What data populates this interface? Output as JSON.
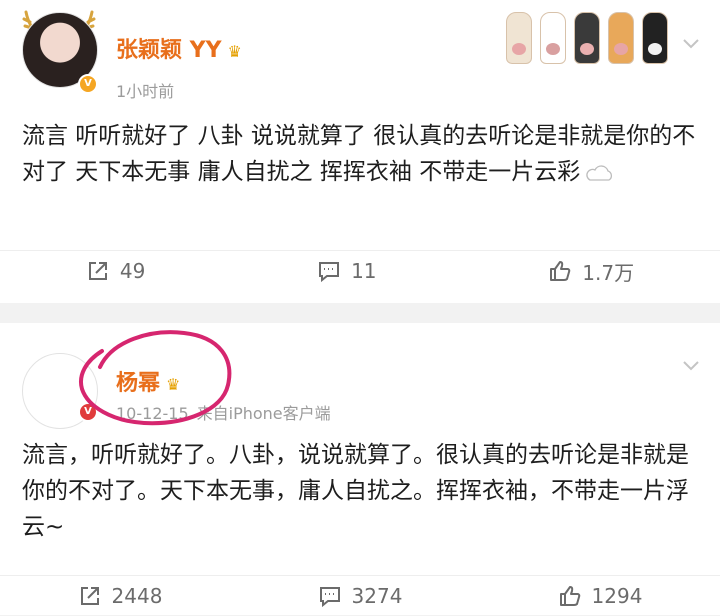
{
  "posts": [
    {
      "username": "张颖颖 YY",
      "time": "1小时前",
      "source": "",
      "text": "流言 听听就好了 八卦 说说就算了 很认真的去听论是非就是你的不对了 天下本无事 庸人自扰之 挥挥衣袖 不带走一片云彩",
      "reposts": "49",
      "comments": "11",
      "likes": "1.7万"
    },
    {
      "username": "杨幂",
      "time": "10-12-15",
      "source": "来自iPhone客户端",
      "text": "流言，听听就好了。八卦，说说就算了。很认真的去听论是非就是你的不对了。天下本无事，庸人自扰之。挥挥衣袖，不带走一片浮云~",
      "reposts": "2448",
      "comments": "3274",
      "likes": "1294"
    }
  ],
  "colors": {
    "username": "#e86f1c",
    "meta": "#9b9b9b",
    "annotation": "#d6266f",
    "page_bg": "#f2f2f2"
  },
  "icons": {
    "repost": "share-icon",
    "comment": "comment-icon",
    "like": "thumbs-up-icon",
    "crown": "crown-icon",
    "verified": "verified-badge-icon",
    "menu": "chevron-down-icon"
  }
}
